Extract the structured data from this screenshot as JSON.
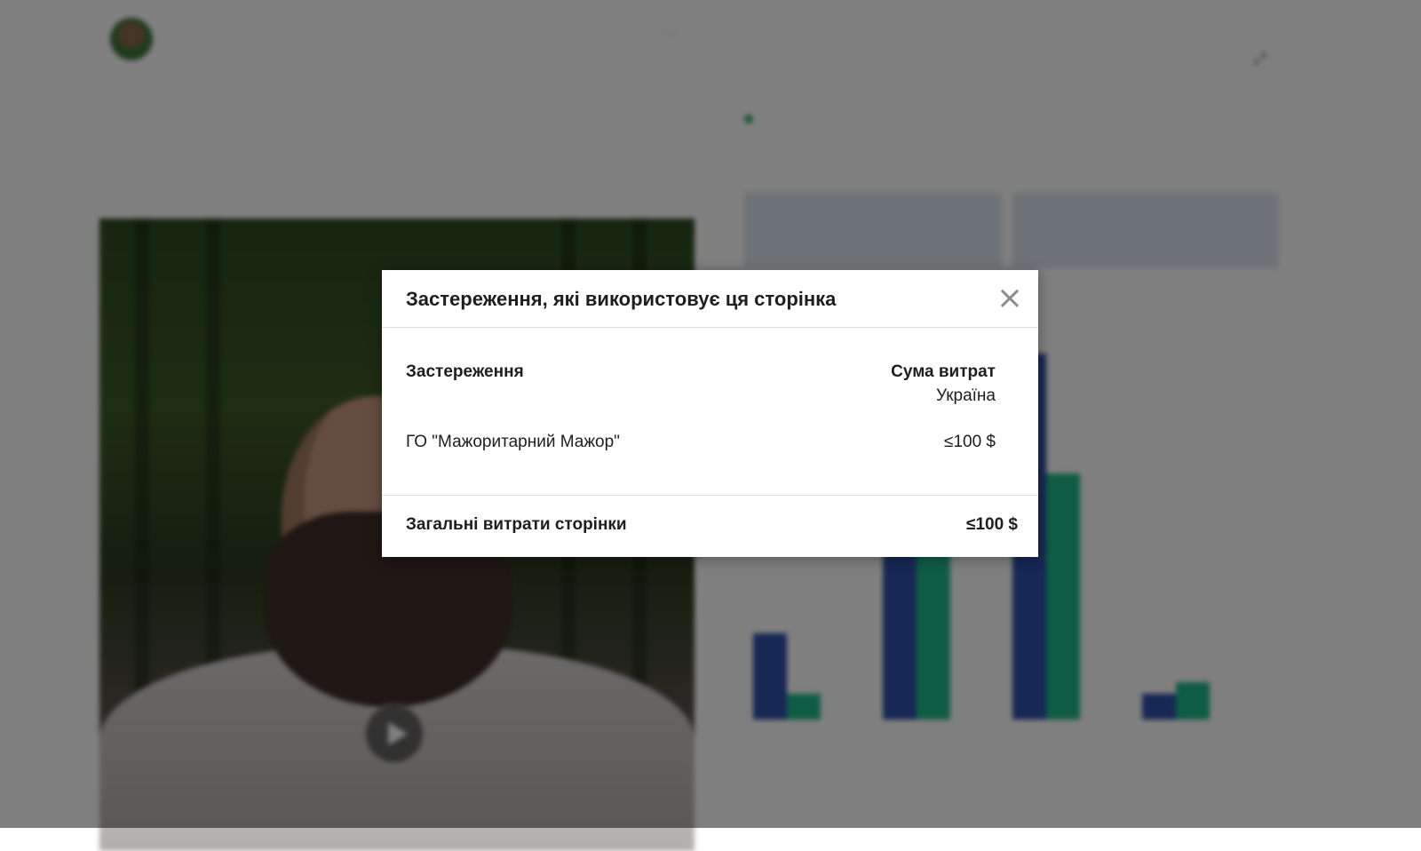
{
  "background": {
    "post": {
      "more_icon": "ellipsis-icon",
      "play_icon": "play-icon"
    },
    "chart": {
      "bars": [
        {
          "group": 0,
          "series": "blue",
          "value": 0.23
        },
        {
          "group": 0,
          "series": "green",
          "value": 0.07
        },
        {
          "group": 1,
          "series": "blue",
          "value": 0.67
        },
        {
          "group": 1,
          "series": "green",
          "value": 0.47
        },
        {
          "group": 2,
          "series": "blue",
          "value": 0.98
        },
        {
          "group": 2,
          "series": "green",
          "value": 0.66
        },
        {
          "group": 3,
          "series": "blue",
          "value": 0.07
        },
        {
          "group": 3,
          "series": "green",
          "value": 0.1
        }
      ],
      "colors": {
        "blue": "#2e4fa8",
        "green": "#1fb98a"
      }
    },
    "status_color": "#2fae5e"
  },
  "modal": {
    "title": "Застереження, які використовує ця сторінка",
    "close_icon": "close-icon",
    "columns": {
      "disclaimer": "Застереження",
      "spend": "Сума витрат",
      "spend_region": "Україна"
    },
    "rows": [
      {
        "name": "ГО \"Мажоритарний Мажор\"",
        "amount": "≤100 $"
      }
    ],
    "footer": {
      "total_label": "Загальні витрати сторінки",
      "total_value": "≤100 $"
    }
  }
}
